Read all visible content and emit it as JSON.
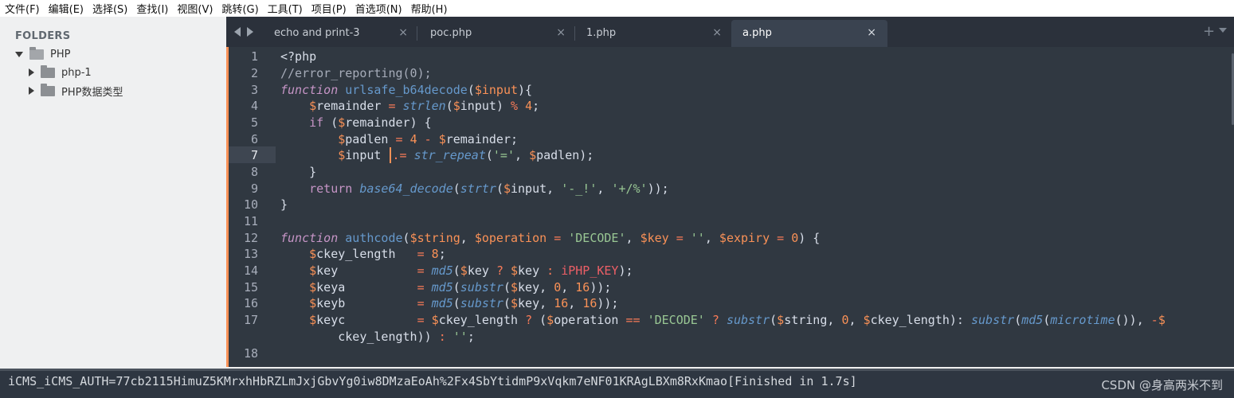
{
  "menu": [
    "文件(F)",
    "编辑(E)",
    "选择(S)",
    "查找(I)",
    "视图(V)",
    "跳转(G)",
    "工具(T)",
    "项目(P)",
    "首选项(N)",
    "帮助(H)"
  ],
  "sidebar": {
    "title": "FOLDERS",
    "root": "PHP",
    "items": [
      "php-1",
      "PHP数据类型"
    ]
  },
  "tabs": [
    {
      "label": "echo and print-3",
      "close": "×"
    },
    {
      "label": "poc.php",
      "close": "×"
    },
    {
      "label": "1.php",
      "close": "×"
    },
    {
      "label": "a.php",
      "close": "×"
    }
  ],
  "tab_add": "+",
  "line_numbers": [
    "1",
    "2",
    "3",
    "4",
    "5",
    "6",
    "7",
    "8",
    "9",
    "10",
    "11",
    "12",
    "13",
    "14",
    "15",
    "16",
    "17",
    "",
    "18"
  ],
  "output": {
    "text": "iCMS_iCMS_AUTH=77cb2115HimuZ5KMrxhHbRZLmJxjGbvYg0iw8DMzaEoAh%2Fx4SbYtidmP9xVqkm7eNF01KRAgLBXm8RxKmao[Finished in 1.7s]",
    "watermark": "CSDN @身高两米不到"
  },
  "colors": {
    "editor_bg": "#303841",
    "accent": "#f99157",
    "keyword": "#c695c6",
    "function": "#6699cc",
    "string": "#99c794"
  },
  "code": {
    "l1": {
      "a": "<?php"
    },
    "l2": {
      "a": "//error_reporting(0);"
    },
    "l3": {
      "a": "function",
      "b": " ",
      "c": "urlsafe_b64decode",
      "d": "(",
      "e": "$",
      "f": "input",
      "g": "){"
    },
    "l4": {
      "a": "    ",
      "b": "$",
      "c": "remainder",
      "d": " ",
      "e": "=",
      "f": " ",
      "g": "strlen",
      "h": "(",
      "i": "$",
      "j": "input",
      "k": ") ",
      "l": "%",
      "m": " ",
      "n": "4",
      "o": ";"
    },
    "l5": {
      "a": "    ",
      "b": "if",
      "c": " (",
      "d": "$",
      "e": "remainder",
      "f": ") {"
    },
    "l6": {
      "a": "        ",
      "b": "$",
      "c": "padlen",
      "d": " ",
      "e": "=",
      "f": " ",
      "g": "4",
      "h": " ",
      "i": "-",
      "j": " ",
      "k": "$",
      "l": "remainder",
      "m": ";"
    },
    "l7": {
      "a": "        ",
      "b": "$",
      "c": "input",
      "d": " ",
      "e": ".=",
      "f": " ",
      "g": "str_repeat",
      "h": "(",
      "i": "'='",
      "j": ", ",
      "k": "$",
      "l": "padlen",
      "m": ");"
    },
    "l8": {
      "a": "    }"
    },
    "l9": {
      "a": "    ",
      "b": "return",
      "c": " ",
      "d": "base64_decode",
      "e": "(",
      "f": "strtr",
      "g": "(",
      "h": "$",
      "i": "input",
      "j": ", ",
      "k": "'-_!'",
      "l": ", ",
      "m": "'+/%'",
      "n": "));"
    },
    "l10": {
      "a": "}"
    },
    "l12": {
      "a": "function",
      "b": " ",
      "c": "authcode",
      "d": "(",
      "e": "$",
      "f": "string",
      "g": ", ",
      "h": "$",
      "i": "operation",
      "j": " ",
      "k": "=",
      "l": " ",
      "m": "'DECODE'",
      "n": ", ",
      "o": "$",
      "p": "key",
      "q": " ",
      "r": "=",
      "s": " ",
      "t": "''",
      "u": ", ",
      "v": "$",
      "w": "expiry",
      "x": " ",
      "y": "=",
      "z": " ",
      "aa": "0",
      "ab": ") {"
    },
    "l13": {
      "a": "    ",
      "b": "$",
      "c": "ckey_length   ",
      "d": "=",
      "e": " ",
      "f": "8",
      "g": ";"
    },
    "l14": {
      "a": "    ",
      "b": "$",
      "c": "key           ",
      "d": "=",
      "e": " ",
      "f": "md5",
      "g": "(",
      "h": "$",
      "i": "key",
      "j": " ",
      "k": "?",
      "l": " ",
      "m": "$",
      "n": "key",
      "o": " ",
      "p": ":",
      "q": " ",
      "r": "iPHP_KEY",
      "s": ");"
    },
    "l15": {
      "a": "    ",
      "b": "$",
      "c": "keya          ",
      "d": "=",
      "e": " ",
      "f": "md5",
      "g": "(",
      "h": "substr",
      "i": "(",
      "j": "$",
      "k": "key",
      "l": ", ",
      "m": "0",
      "n": ", ",
      "o": "16",
      "p": "));"
    },
    "l16": {
      "a": "    ",
      "b": "$",
      "c": "keyb          ",
      "d": "=",
      "e": " ",
      "f": "md5",
      "g": "(",
      "h": "substr",
      "i": "(",
      "j": "$",
      "k": "key",
      "l": ", ",
      "m": "16",
      "n": ", ",
      "o": "16",
      "p": "));"
    },
    "l17": {
      "a": "    ",
      "b": "$",
      "c": "keyc          ",
      "d": "=",
      "e": " ",
      "f": "$",
      "g": "ckey_length",
      "h": " ",
      "i": "?",
      "j": " (",
      "k": "$",
      "l": "operation",
      "m": " ",
      "n": "==",
      "o": " ",
      "p": "'DECODE'",
      "q": " ",
      "r": "?",
      "s": " ",
      "t": "substr",
      "u": "(",
      "v": "$",
      "w": "string",
      "x": ", ",
      "y": "0",
      "z": ", ",
      "aa": "$",
      "ab": "ckey_length",
      "ac": "): ",
      "ad": "substr",
      "ae": "(",
      "af": "md5",
      "ag": "(",
      "ah": "microtime",
      "ai": "()), ",
      "aj": "-",
      "ak": "$"
    },
    "l17b": {
      "a": "        ckey_length",
      "b": ")) ",
      "c": ":",
      "d": " ",
      "e": "''",
      "f": ";"
    }
  }
}
